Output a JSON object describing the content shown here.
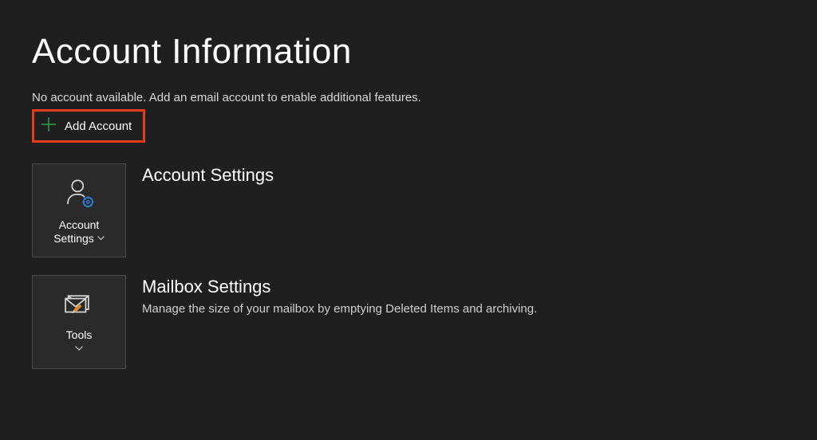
{
  "page": {
    "title": "Account Information",
    "noAccountMessage": "No account available. Add an email account to enable additional features.",
    "addAccountLabel": "Add Account"
  },
  "sections": {
    "accountSettings": {
      "tileLabelLine1": "Account",
      "tileLabelLine2": "Settings",
      "heading": "Account Settings"
    },
    "mailboxSettings": {
      "tileLabel": "Tools",
      "heading": "Mailbox Settings",
      "description": "Manage the size of your mailbox by emptying Deleted Items and archiving."
    }
  },
  "colors": {
    "highlightBorder": "#e23b1e",
    "plusGreen": "#2aa148",
    "gearBlue": "#2a7fd4",
    "brushOrange": "#d98b2b"
  }
}
